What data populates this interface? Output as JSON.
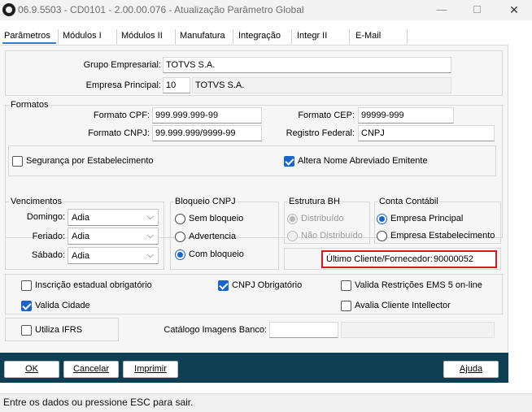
{
  "window": {
    "title": "06.9.5503 - CD0101 - 2.00.00.076 - Atualização Parâmetro Global",
    "minimize": "—",
    "close": "✕"
  },
  "tabs": [
    {
      "label": "Parâmetros",
      "active": true
    },
    {
      "label": "Módulos I"
    },
    {
      "label": "Módulos II"
    },
    {
      "label": "Manufatura"
    },
    {
      "label": "Integração"
    },
    {
      "label": "Integr II"
    },
    {
      "label": "E-Mail"
    }
  ],
  "empresa": {
    "grupo_label": "Grupo Empresarial:",
    "grupo_value": "TOTVS S.A.",
    "principal_label": "Empresa Principal:",
    "principal_code": "10",
    "principal_name": "TOTVS S.A."
  },
  "formatos": {
    "title": "Formatos",
    "cpf_label": "Formato CPF:",
    "cpf_value": "999.999.999-99",
    "cnpj_label": "Formato CNPJ:",
    "cnpj_value": "99.999.999/9999-99",
    "cep_label": "Formato CEP:",
    "cep_value": "99999-999",
    "registro_label": "Registro Federal:",
    "registro_value": "CNPJ",
    "seguranca_label": "Segurança por Estabelecimento",
    "seguranca_checked": false,
    "altera_label": "Altera Nome Abreviado Emitente",
    "altera_checked": true
  },
  "vencimentos": {
    "title": "Vencimentos",
    "domingo_label": "Domingo:",
    "domingo_value": "Adia",
    "feriado_label": "Feriado:",
    "feriado_value": "Adia",
    "sabado_label": "Sábado:",
    "sabado_value": "Adia"
  },
  "bloqueio_cnpj": {
    "title": "Bloqueio CNPJ",
    "options": [
      "Sem bloqueio",
      "Advertencia",
      "Com bloqueio"
    ],
    "selected": 2
  },
  "estrutura_bh": {
    "title": "Estrutura BH",
    "options": [
      "Distribuído",
      "Não Distribuído"
    ],
    "selected": 0,
    "disabled": true
  },
  "conta_contabil": {
    "title": "Conta Contábil",
    "options": [
      "Empresa Principal",
      "Empresa Estabelecimento"
    ],
    "selected": 0
  },
  "ultimo_cliente": {
    "label": "Último Cliente/Fornecedor:",
    "value": "90000052"
  },
  "options": {
    "inscricao_label": "Inscrição estadual obrigatório",
    "inscricao_checked": false,
    "cnpj_obrig_label": "CNPJ Obrigatório",
    "cnpj_obrig_checked": true,
    "valida_restr_label": "Valida Restrições EMS 5 on-line",
    "valida_restr_checked": false,
    "valida_cidade_label": "Valida Cidade",
    "valida_cidade_checked": true,
    "avalia_label": "Avalia Cliente Intellector",
    "avalia_checked": false
  },
  "ifrs": {
    "label": "Utiliza IFRS",
    "checked": false,
    "catalogo_label": "Catálogo Imagens Banco:",
    "catalogo_value": ""
  },
  "buttons": {
    "ok": "OK",
    "cancelar": "Cancelar",
    "imprimir": "Imprimir",
    "ajuda": "Ajuda"
  },
  "status": {
    "text": "Entre os dados ou pressione ESC para sair."
  },
  "colors": {
    "accent": "#1a64c8",
    "button_bar": "#0f3f52",
    "highlight": "#e0141c"
  }
}
